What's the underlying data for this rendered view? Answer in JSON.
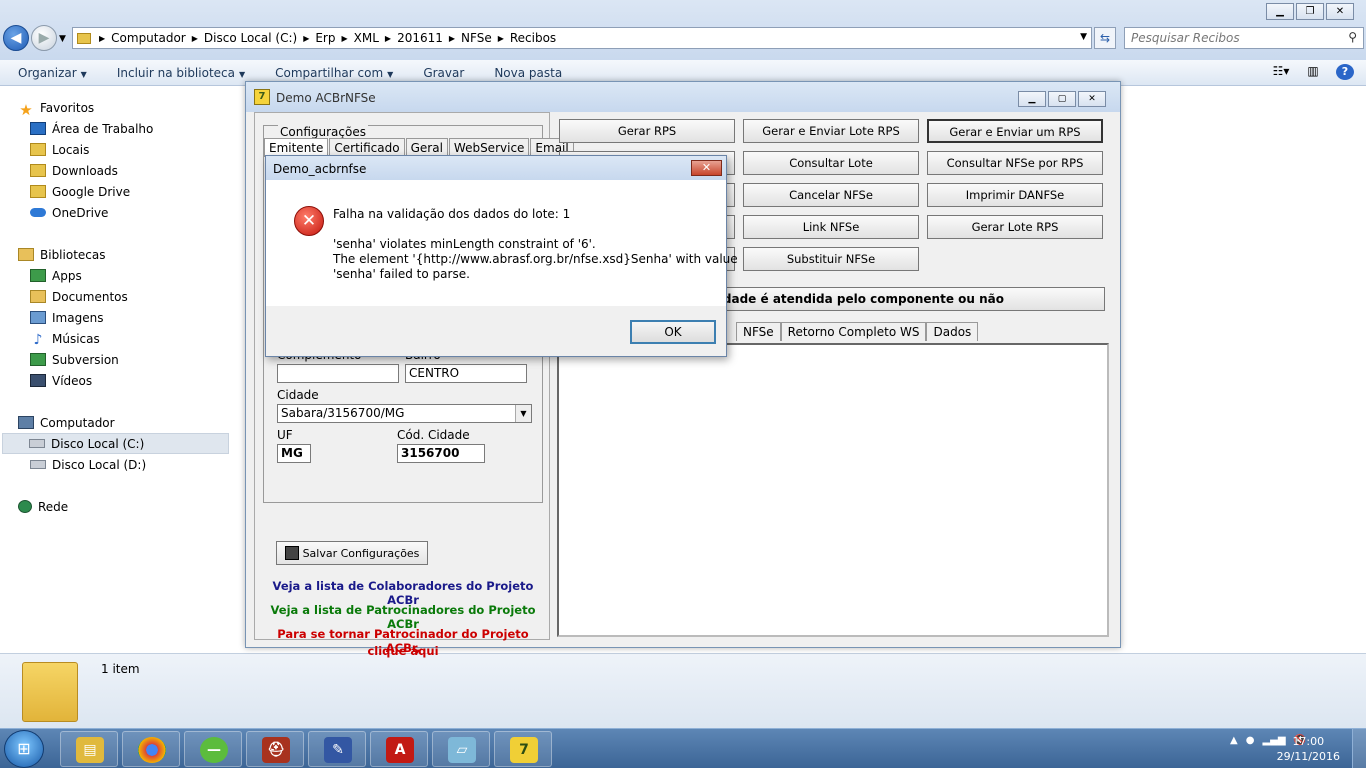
{
  "explorer": {
    "breadcrumb": [
      "Computador",
      "Disco Local (C:)",
      "Erp",
      "XML",
      "201611",
      "NFSe",
      "Recibos"
    ],
    "search_placeholder": "Pesquisar Recibos",
    "toolbar": {
      "organize": "Organizar",
      "include_library": "Incluir na biblioteca",
      "share_with": "Compartilhar com",
      "burn": "Gravar",
      "new_folder": "Nova pasta"
    },
    "nav": {
      "favorites": "Favoritos",
      "desktop": "Área de Trabalho",
      "locals": "Locais",
      "downloads": "Downloads",
      "google_drive": "Google Drive",
      "onedrive": "OneDrive",
      "libraries": "Bibliotecas",
      "apps": "Apps",
      "documents": "Documentos",
      "images": "Imagens",
      "music": "Músicas",
      "subversion": "Subversion",
      "videos": "Vídeos",
      "computer": "Computador",
      "disk_c": "Disco Local (C:)",
      "disk_d": "Disco Local (D:)",
      "network": "Rede"
    },
    "status_count": "1 item"
  },
  "acbr": {
    "title": "Demo ACBrNFSe",
    "config_label": "Configurações",
    "tabs": [
      "Emitente",
      "Certificado",
      "Geral",
      "WebService",
      "Email"
    ],
    "complemento_label": "Complemento",
    "complemento_value": "",
    "bairro_label": "Bairro",
    "bairro_value": "CENTRO",
    "cidade_label": "Cidade",
    "cidade_value": "Sabara/3156700/MG",
    "uf_label": "UF",
    "uf_value": "MG",
    "cod_cidade_label": "Cód. Cidade",
    "cod_cidade_value": "3156700",
    "save_button": "Salvar Configurações",
    "link_colab": "Veja a lista de Colaboradores do Projeto ACBr",
    "link_patroc": "Veja a lista de Patrocinadores do Projeto ACBr",
    "link_tornar_1": "Para se tornar Patrocinador do Projeto ACBr,",
    "link_tornar_2": "clique aqui",
    "buttons": {
      "gerar_rps": "Gerar RPS",
      "gerar_enviar_lote": "Gerar e Enviar Lote RPS",
      "gerar_enviar_um": "Gerar e Enviar um RPS",
      "consultar_lote": "Consultar Lote",
      "consultar_nfse_rps": "Consultar NFSe por RPS",
      "cancelar_nfse": "Cancelar NFSe",
      "imprimir_danfse": "Imprimir DANFSe",
      "link_nfse": "Link NFSe",
      "gerar_lote_rps": "Gerar Lote RPS",
      "substituir_nfse": "Substituir NFSe",
      "verificar_cidade": "uma cidade é atendida pelo componente ou não"
    },
    "result_tabs": [
      "NFSe",
      "Retorno Completo WS",
      "Dados"
    ]
  },
  "dialog": {
    "title": "Demo_acbrnfse",
    "close_label": "✕",
    "line1": "Falha na validação dos dados do lote: 1",
    "line2": "'senha' violates minLength constraint of '6'.",
    "line3": "The element '{http://www.abrasf.org.br/nfse.xsd}Senha' with value",
    "line4": "'senha' failed to parse.",
    "ok": "OK"
  },
  "taskbar": {
    "time": "17:00",
    "date": "29/11/2016"
  },
  "colors": {
    "link_blue": "#1a1a8a",
    "link_green": "#0a7a0a",
    "link_red": "#cc0000"
  }
}
